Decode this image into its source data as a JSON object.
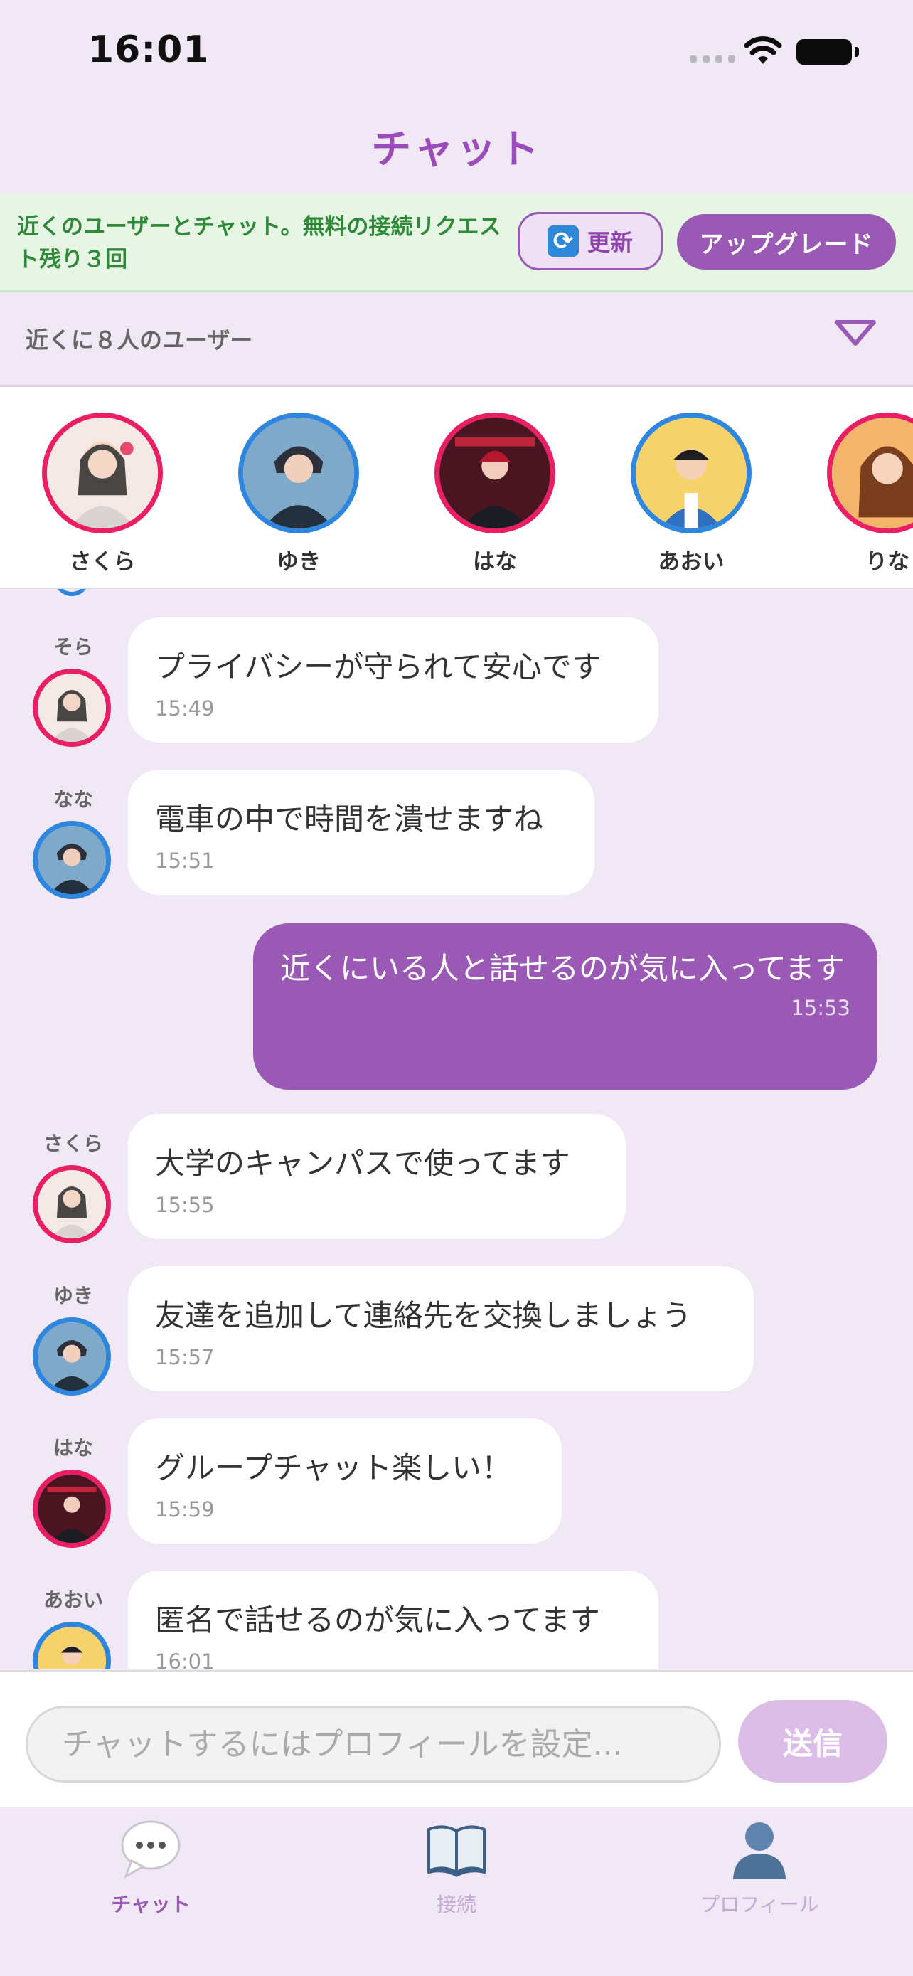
{
  "status_bar": {
    "time": "16:01"
  },
  "header": {
    "title": "チャット"
  },
  "banner": {
    "text": "近くのユーザーとチャット。無料の接続リクエスト残り３回",
    "refresh_label": "更新",
    "upgrade_label": "アップグレード"
  },
  "nearby": {
    "label": "近くに８人のユーザー"
  },
  "users": [
    {
      "name": "さくら",
      "ring": "pink"
    },
    {
      "name": "ゆき",
      "ring": "blue"
    },
    {
      "name": "はな",
      "ring": "pink"
    },
    {
      "name": "あおい",
      "ring": "blue"
    },
    {
      "name": "りな",
      "ring": "pink"
    }
  ],
  "messages": [
    {
      "sender": "そら",
      "text": "プライバシーが守られて安心です",
      "time": "15:49",
      "own": false
    },
    {
      "sender": "なな",
      "text": "電車の中で時間を潰せますね",
      "time": "15:51",
      "own": false
    },
    {
      "sender": "",
      "text": "近くにいる人と話せるのが気に入ってます",
      "time": "15:53",
      "own": true
    },
    {
      "sender": "さくら",
      "text": "大学のキャンパスで使ってます",
      "time": "15:55",
      "own": false
    },
    {
      "sender": "ゆき",
      "text": "友達を追加して連絡先を交換しましょう",
      "time": "15:57",
      "own": false
    },
    {
      "sender": "はな",
      "text": "グループチャット楽しい！",
      "time": "15:59",
      "own": false
    },
    {
      "sender": "あおい",
      "text": "匿名で話せるのが気に入ってます",
      "time": "16:01",
      "own": false
    }
  ],
  "composer": {
    "placeholder": "チャットするにはプロフィールを設定...",
    "send_label": "送信"
  },
  "tabs": [
    {
      "label": "チャット",
      "icon": "speech-bubble-icon",
      "active": true
    },
    {
      "label": "接続",
      "icon": "book-icon",
      "active": false
    },
    {
      "label": "プロフィール",
      "icon": "person-silhouette-icon",
      "active": false
    }
  ],
  "colors": {
    "accent": "#9b59b6",
    "pink_ring": "#e91e63",
    "blue_ring": "#2e86de",
    "banner_bg": "#e6f5e4",
    "banner_text": "#2f8a37"
  }
}
